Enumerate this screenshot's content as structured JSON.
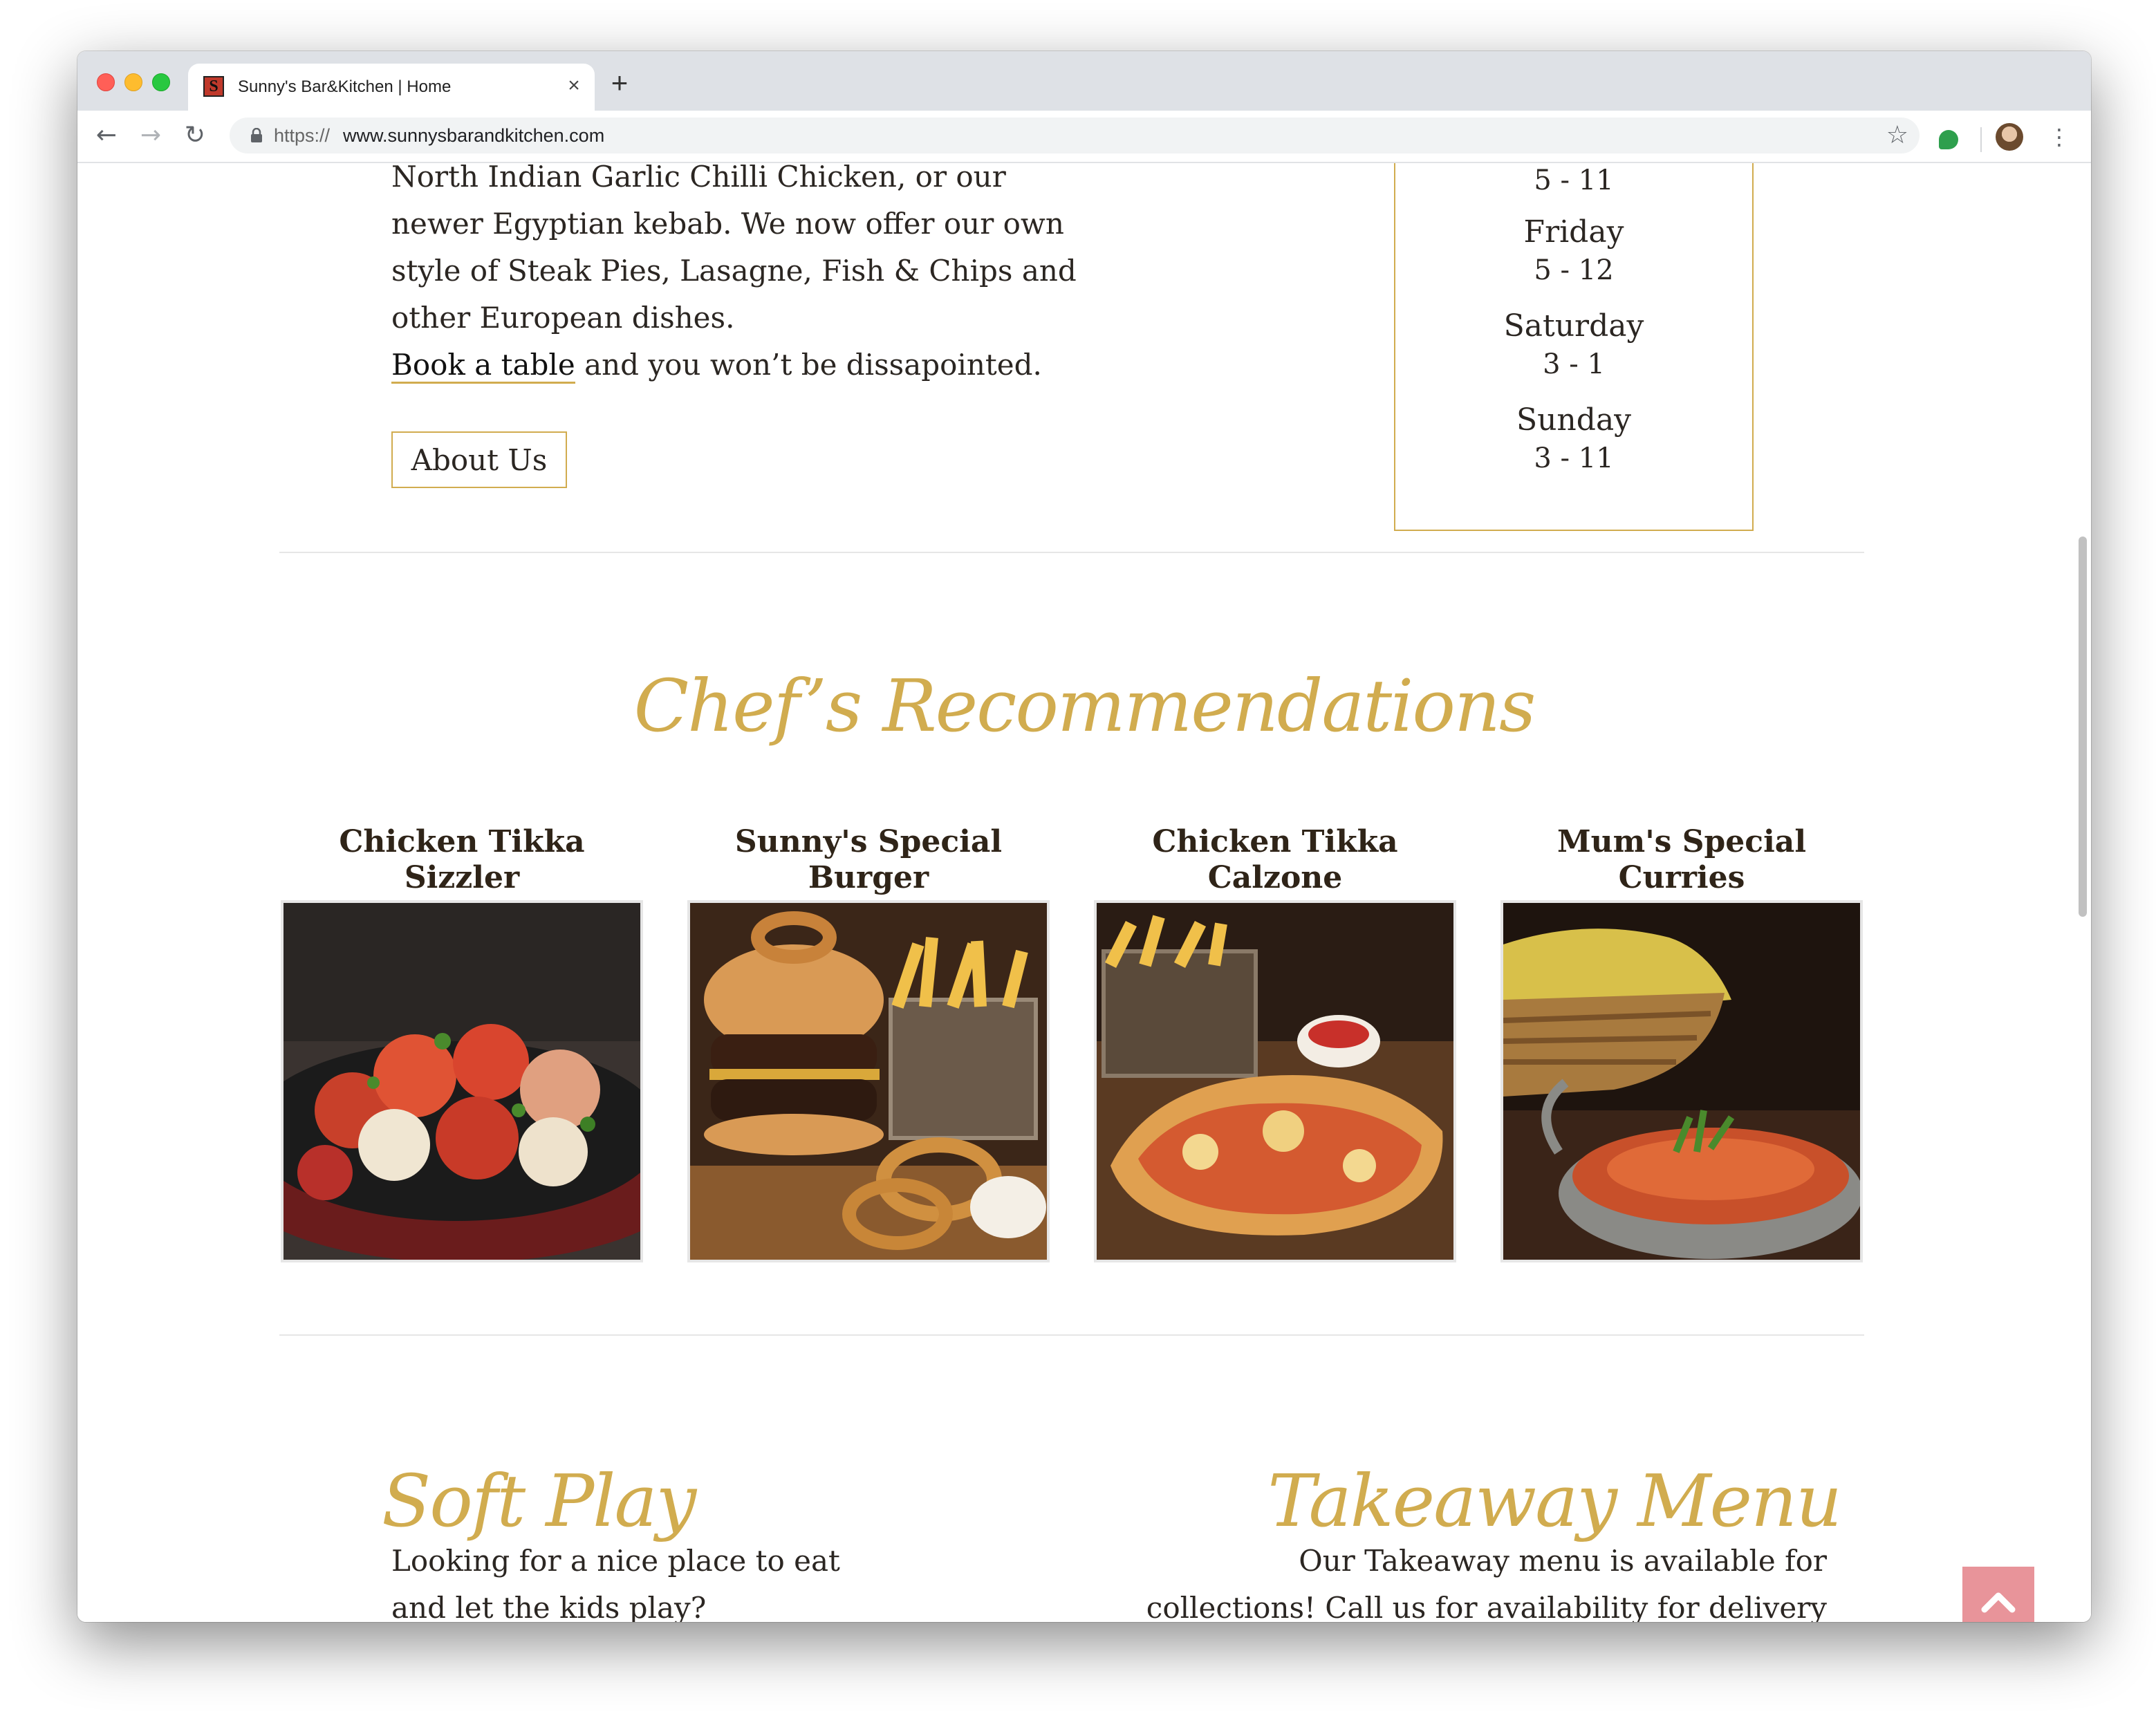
{
  "browser": {
    "tab_title": "Sunny's Bar&Kitchen | Home",
    "favicon_letter": "S",
    "url_prefix": "https://",
    "url_host": "www.sunnysbarandkitchen.com"
  },
  "intro": {
    "lines": [
      "North Indian Garlic Chilli Chicken, or our",
      "newer Egyptian kebab. We now offer our own",
      "style of Steak Pies, Lasagne, Fish & Chips and",
      "other European dishes."
    ],
    "book_link": "Book a table",
    "book_rest": " and you won’t be dissapointed.",
    "about_button": "About Us"
  },
  "hours": {
    "partial_time": "5 - 11",
    "entries": [
      {
        "day": "Friday",
        "time": "5 - 12"
      },
      {
        "day": "Saturday",
        "time": "3 - 1"
      },
      {
        "day": "Sunday",
        "time": "3 - 11"
      }
    ]
  },
  "chefs": {
    "heading": "Chef’s Recommendations",
    "items": [
      {
        "line1": "Chicken Tikka",
        "line2": "Sizzler"
      },
      {
        "line1": "Sunny's Special",
        "line2": "Burger"
      },
      {
        "line1": "Chicken Tikka",
        "line2": "Calzone"
      },
      {
        "line1": "Mum's Special",
        "line2": "Curries"
      }
    ]
  },
  "soft_play": {
    "heading": "Soft Play",
    "lines": [
      "Looking for a nice place to eat",
      "and let the kids play?"
    ]
  },
  "takeaway": {
    "heading": "Takeaway Menu",
    "lines": [
      "Our Takeaway menu is available for",
      "collections! Call us for availability for delivery"
    ]
  },
  "colors": {
    "accent_gold": "#d1ac4f",
    "scroll_top_button": "#e8949a"
  }
}
